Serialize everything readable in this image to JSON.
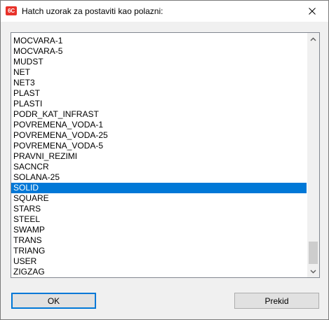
{
  "window": {
    "title": "Hatch uzorak za postaviti kao polazni:",
    "app_icon_text": "6C",
    "app_icon_color": "#e8322a"
  },
  "list": {
    "selected_index": 14,
    "items": [
      "MOCVARA-1",
      "MOCVARA-5",
      "MUDST",
      "NET",
      "NET3",
      "PLAST",
      "PLASTI",
      "PODR_KAT_INFRAST",
      "POVREMENA_VODA-1",
      "POVREMENA_VODA-25",
      "POVREMENA_VODA-5",
      "PRAVNI_REZIMI",
      "SACNCR",
      "SOLANA-25",
      "SOLID",
      "SQUARE",
      "STARS",
      "STEEL",
      "SWAMP",
      "TRANS",
      "TRIANG",
      "USER",
      "ZIGZAG"
    ],
    "selection_color": "#0078d7",
    "scroll_position": 1.0
  },
  "buttons": {
    "ok_label": "OK",
    "cancel_label": "Prekid"
  },
  "icons": {
    "close": "close-icon",
    "scroll_up": "scroll-up-arrow-icon",
    "scroll_down": "scroll-down-arrow-icon"
  }
}
